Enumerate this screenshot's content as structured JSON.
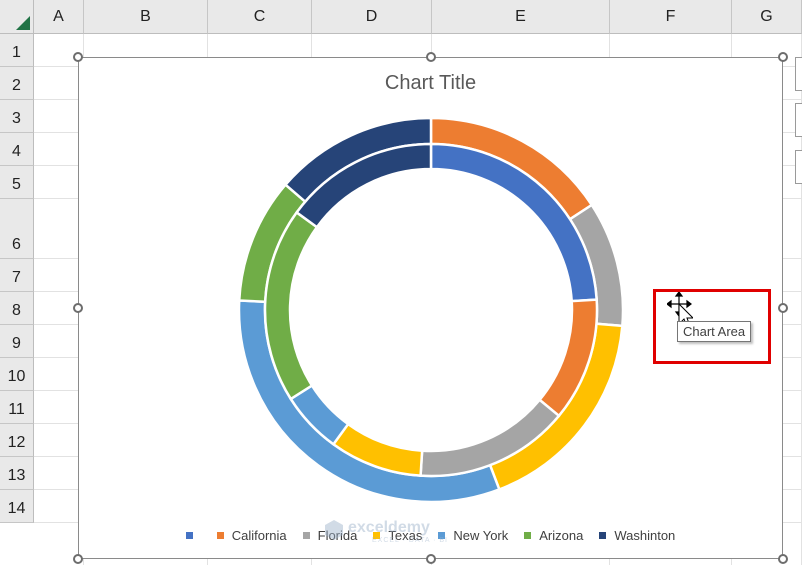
{
  "spreadsheet": {
    "columns": [
      "A",
      "B",
      "C",
      "D",
      "E",
      "F",
      "G"
    ],
    "rows": [
      "1",
      "2",
      "3",
      "4",
      "5",
      "6",
      "7",
      "8",
      "9",
      "10",
      "11",
      "12",
      "13",
      "14"
    ]
  },
  "chart": {
    "title": "Chart Title",
    "tooltip": "Chart Area",
    "legend": [
      "",
      "California",
      "Florida",
      "Texas",
      "New York",
      "Arizona",
      "Washinton"
    ],
    "watermark": {
      "name": "exceldemy",
      "tagline": "EXCEL · DATA · BI"
    }
  },
  "chart_data": {
    "type": "pie",
    "subtype": "doughnut",
    "title": "Chart Title",
    "categories": [
      "",
      "California",
      "Florida",
      "Texas",
      "New York",
      "Arizona",
      "Washinton"
    ],
    "colors": [
      "#4472C4",
      "#ED7D31",
      "#A5A5A5",
      "#FFC000",
      "#5B9BD5",
      "#70AD47",
      "#264478"
    ],
    "series": [
      {
        "values": [
          0,
          15,
          10,
          17,
          30,
          10,
          13
        ]
      },
      {
        "values": [
          24,
          12,
          15,
          9,
          6,
          19,
          15
        ]
      }
    ],
    "legend_position": "bottom"
  }
}
